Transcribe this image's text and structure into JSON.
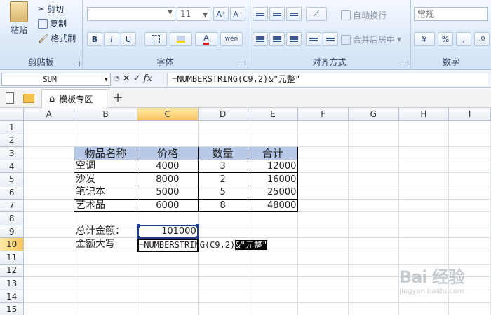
{
  "ribbon": {
    "clipboard": {
      "paste": "粘贴",
      "cut": "剪切",
      "copy": "复制",
      "format_painter": "格式刷",
      "label": "剪贴板"
    },
    "font": {
      "name_value": "",
      "size_value": "11",
      "grow": "A⁺",
      "shrink": "A⁻",
      "bold": "B",
      "italic": "I",
      "underline": "U",
      "label": "字体"
    },
    "alignment": {
      "wrap": "自动换行",
      "merge": "合并后居中",
      "label": "对齐方式"
    },
    "number": {
      "format_value": "常规",
      "percent": "%",
      "label": "数字"
    }
  },
  "formula_bar": {
    "name_box": "SUM",
    "cancel": "✕",
    "confirm": "✓",
    "fx": "fx",
    "formula": "=NUMBERSTRING(C9,2)&\"元整\""
  },
  "tabs": {
    "template_tab": "模板专区",
    "add": "+"
  },
  "grid": {
    "columns": [
      "A",
      "B",
      "C",
      "D",
      "E",
      "F",
      "G",
      "H",
      "I"
    ],
    "rows": [
      "1",
      "2",
      "3",
      "4",
      "5",
      "6",
      "7",
      "8",
      "9",
      "10",
      "11",
      "12",
      "13",
      "14",
      "15"
    ],
    "table_headers": [
      "物品名称",
      "价格",
      "数量",
      "合计"
    ],
    "items": [
      {
        "name": "空调",
        "price": "4000",
        "qty": "3",
        "total": "12000"
      },
      {
        "name": "沙发",
        "price": "8000",
        "qty": "2",
        "total": "16000"
      },
      {
        "name": "笔记本",
        "price": "5000",
        "qty": "5",
        "total": "25000"
      },
      {
        "name": "艺术品",
        "price": "6000",
        "qty": "8",
        "total": "48000"
      }
    ],
    "total_label": "总计金额：",
    "total_value": "101000",
    "uppercase_label": "金额大写",
    "edit_formula_plain": "=NUMBERSTRING(C9,2)",
    "edit_formula_highlight": "&\"元整\""
  },
  "watermark": {
    "logo": "Bai 经验",
    "sub": "jingyan.baidu.com"
  },
  "colors": {
    "header_fill": "#b7c9e6",
    "active_header": "#f7c55a",
    "selection": "#1e3e8c"
  }
}
